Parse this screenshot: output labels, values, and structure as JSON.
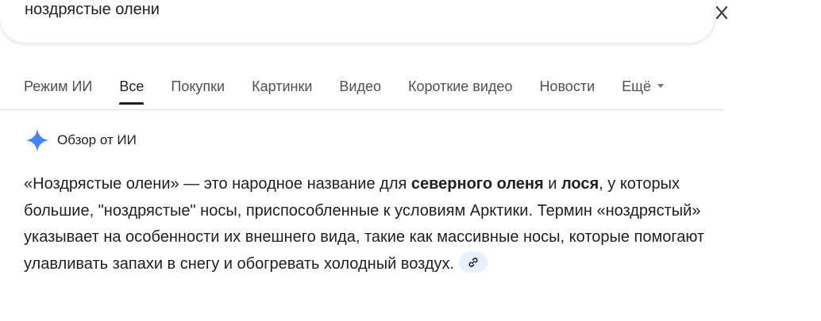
{
  "search": {
    "query": "ноздрястые олени"
  },
  "tabs": [
    {
      "label": "Режим ИИ",
      "active": false
    },
    {
      "label": "Все",
      "active": true
    },
    {
      "label": "Покупки",
      "active": false
    },
    {
      "label": "Картинки",
      "active": false
    },
    {
      "label": "Видео",
      "active": false
    },
    {
      "label": "Короткие видео",
      "active": false
    },
    {
      "label": "Новости",
      "active": false
    },
    {
      "label": "Ещё",
      "active": false
    }
  ],
  "ai_overview": {
    "header_label": "Обзор от ИИ",
    "text": {
      "part1": "«Ноздрястые олени» — это народное название для ",
      "bold1": "северного оленя",
      "part2": " и ",
      "bold2": "лося",
      "part3": ", у которых большие, \"ноздрястые\" носы, приспособленные к условиям Арктики. Термин «ноздрястый» указывает на особенности их внешнего вида, такие как массивные носы, которые помогают улавливать запахи в снегу и обогревать холодный воздух."
    }
  },
  "icons": {
    "clear": "close-icon",
    "sparkle": "gemini-sparkle-icon",
    "link": "link-icon",
    "more": "caret-down-icon"
  },
  "colors": {
    "sparkle_blue": "#4285f4",
    "chip_bg": "#e8f0fe",
    "tab_inactive": "#4d5156",
    "text": "#1f1f1f"
  }
}
